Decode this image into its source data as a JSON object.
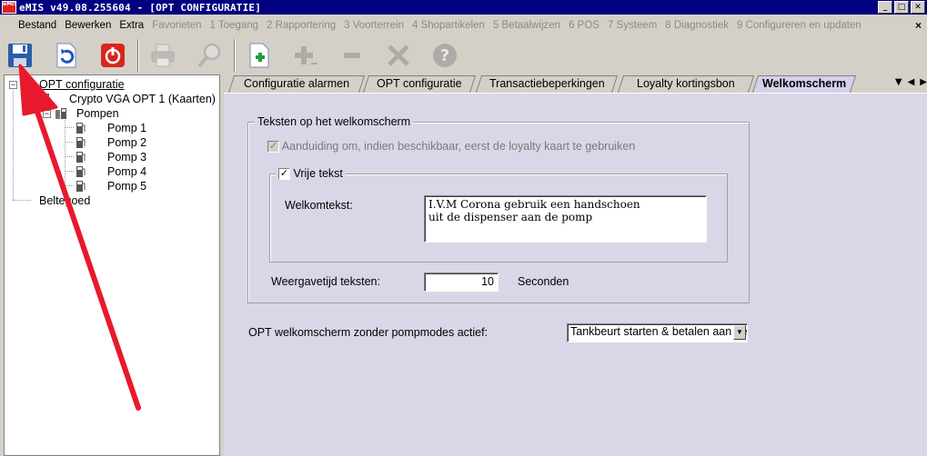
{
  "window": {
    "title": "eMIS v49.08.255604 - [OPT CONFIGURATIE]",
    "app_icon_text": "eMIS",
    "minimize": "_",
    "maximize": "□",
    "close": "✕"
  },
  "menu": {
    "items": [
      {
        "label": "Bestand",
        "enabled": true
      },
      {
        "label": "Bewerken",
        "enabled": true
      },
      {
        "label": "Extra",
        "enabled": true
      },
      {
        "label": "Favorieten",
        "enabled": false
      },
      {
        "label": "1 Toegang",
        "enabled": false
      },
      {
        "label": "2 Rapportering",
        "enabled": false
      },
      {
        "label": "3 Voorterrein",
        "enabled": false
      },
      {
        "label": "4 Shopartikelen",
        "enabled": false
      },
      {
        "label": "5 Betaalwijzen",
        "enabled": false
      },
      {
        "label": "6 POS",
        "enabled": false
      },
      {
        "label": "7 Systeem",
        "enabled": false
      },
      {
        "label": "8 Diagnostiek",
        "enabled": false
      },
      {
        "label": "9 Configureren en updaten",
        "enabled": false
      }
    ],
    "close": "×"
  },
  "toolbar": {
    "buttons": [
      {
        "name": "save",
        "icon": "floppy-disk-icon",
        "enabled": true
      },
      {
        "name": "undo",
        "icon": "undo-icon",
        "enabled": true
      },
      {
        "name": "exit",
        "icon": "power-icon",
        "enabled": true
      },
      {
        "name": "print",
        "icon": "printer-icon",
        "enabled": false
      },
      {
        "name": "search",
        "icon": "magnifier-icon",
        "enabled": false
      },
      {
        "name": "new",
        "icon": "new-document-icon",
        "enabled": true
      },
      {
        "name": "add",
        "icon": "plus-icon",
        "enabled": false
      },
      {
        "name": "remove",
        "icon": "minus-icon",
        "enabled": false
      },
      {
        "name": "tools",
        "icon": "tools-icon",
        "enabled": false
      },
      {
        "name": "help",
        "icon": "help-icon",
        "enabled": false
      }
    ]
  },
  "tree": {
    "root": "OPT configuratie",
    "device": "Crypto VGA OPT 1 (Kaarten)",
    "pumps_group": "Pompen",
    "pumps": [
      "Pomp 1",
      "Pomp 2",
      "Pomp 3",
      "Pomp 4",
      "Pomp 5"
    ],
    "other": "Beltegoed"
  },
  "tabs": [
    {
      "label": "Configuratie alarmen",
      "active": false
    },
    {
      "label": "OPT configuratie",
      "active": false
    },
    {
      "label": "Transactiebeperkingen",
      "active": false
    },
    {
      "label": "Loyalty kortingsbon",
      "active": false
    },
    {
      "label": "Welkomscherm",
      "active": true
    }
  ],
  "tab_scroll": {
    "menu": "▼",
    "left": "◀",
    "right": "▶"
  },
  "welcome": {
    "group_title": "Teksten op het welkomscherm",
    "loyalty_checkbox_label": "Aanduiding om, indien beschikbaar, eerst de loyalty kaart te gebruiken",
    "loyalty_checked": true,
    "free_text_label": "Vrije tekst",
    "free_text_checked": true,
    "welcome_text_label": "Welkomtekst:",
    "welcome_text_value": "I.V.M Corona gebruik een handschoen\nuit de dispenser aan de pomp",
    "display_time_label": "Weergavetijd teksten:",
    "display_time_value": "10",
    "display_time_unit": "Seconden",
    "no_pump_mode_label": "OPT welkomscherm zonder pompmodes actief:",
    "no_pump_mode_value": "Tankbeurt starten & betalen aan de pomp",
    "check_mark": "✓"
  }
}
